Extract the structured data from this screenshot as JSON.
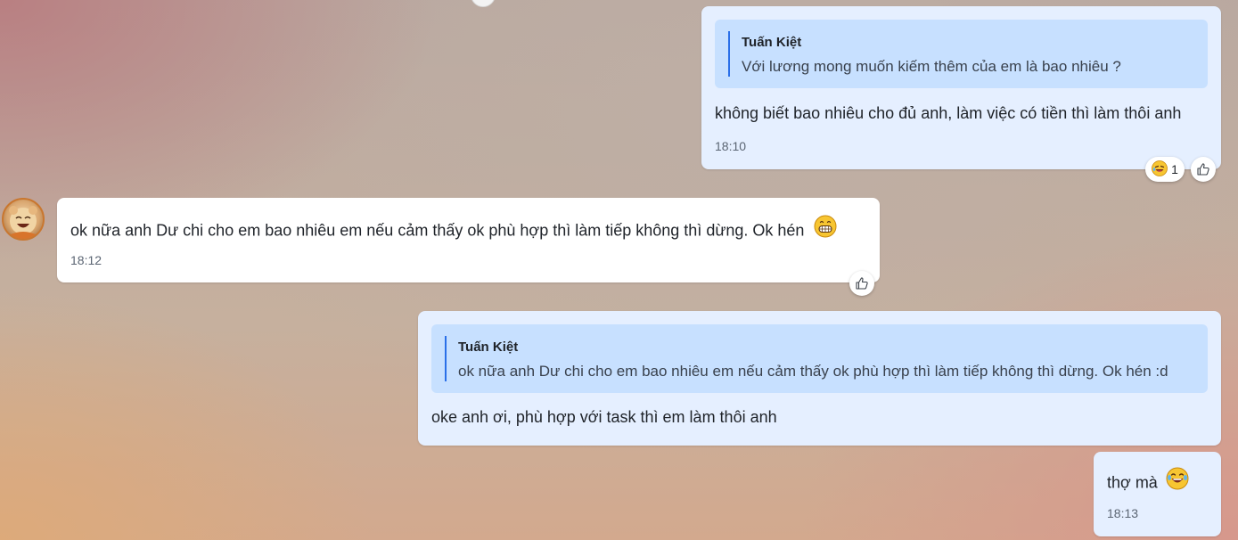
{
  "messages": [
    {
      "quote": {
        "author": "Tuấn Kiệt",
        "text": "Với lương mong muốn kiếm thêm của em là bao nhiêu ?"
      },
      "text": "không biết bao nhiêu cho đủ anh, làm việc có tiền thì làm thôi anh",
      "time": "18:10",
      "reaction": {
        "icon": "laughing-face-icon",
        "count": "1"
      }
    },
    {
      "text": "ok nữa anh Dư chi cho em bao nhiêu em nếu cảm thấy ok phù hợp thì làm tiếp không thì dừng. Ok hén",
      "emoji": "grinning-face-icon",
      "time": "18:12"
    },
    {
      "quote": {
        "author": "Tuấn Kiệt",
        "text": "ok nữa anh Dư chi cho em bao nhiêu em nếu cảm thấy ok phù hợp thì làm tiếp không thì dừng. Ok hén :d"
      },
      "text": "oke anh ơi, phù hợp với task thì em làm thôi anh"
    },
    {
      "text": "thợ mà",
      "emoji": "tears-of-joy-icon",
      "time": "18:13"
    }
  ],
  "colors": {
    "own_bubble": "#e5efff",
    "other_bubble": "#ffffff",
    "quote_background": "#c7e0ff",
    "quote_bar": "#2a6fe8"
  }
}
